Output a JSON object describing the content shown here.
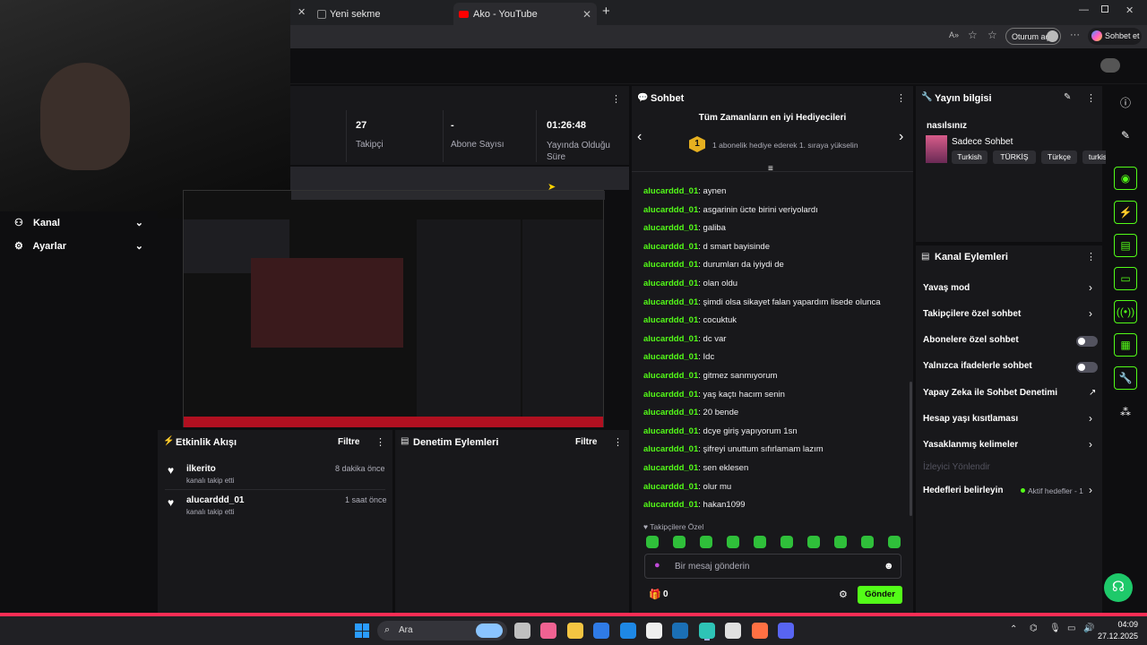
{
  "browser": {
    "tabs": [
      {
        "label": "Yeni sekme"
      },
      {
        "label": "Ako - YouTube"
      }
    ],
    "signin_label": "Oturum aç",
    "copilot_label": "Sohbet et"
  },
  "stats": [
    {
      "value": "27",
      "label": "Takipçi"
    },
    {
      "value": "-",
      "label": "Abone Sayısı"
    },
    {
      "value": "01:26:48",
      "label": "Yayında Olduğu Süre"
    }
  ],
  "sidebar": {
    "items": [
      {
        "label": "Kanal"
      },
      {
        "label": "Ayarlar"
      }
    ]
  },
  "activity": {
    "title": "Etkinlik Akışı",
    "filter": "Filtre",
    "events": [
      {
        "user": "ilkerito",
        "text": "kanalı takip etti",
        "time": "8 dakika önce"
      },
      {
        "user": "alucarddd_01",
        "text": "kanalı takip etti",
        "time": "1 saat önce"
      }
    ]
  },
  "moderation": {
    "title": "Denetim Eylemleri",
    "filter": "Filtre"
  },
  "chat": {
    "title": "Sohbet",
    "banner_title": "Tüm Zamanların en iyi Hediyecileri",
    "banner_rank": "1",
    "banner_text": "1 abonelik hediye ederek 1. sıraya yükselin",
    "messages": [
      {
        "user": "alucarddd_01",
        "text": "aynen"
      },
      {
        "user": "alucarddd_01",
        "text": "asgarinin ücte birini veriyolardı"
      },
      {
        "user": "alucarddd_01",
        "text": "galiba"
      },
      {
        "user": "alucarddd_01",
        "text": "d smart bayisinde"
      },
      {
        "user": "alucarddd_01",
        "text": "durumları da iyiydi de"
      },
      {
        "user": "alucarddd_01",
        "text": "olan oldu"
      },
      {
        "user": "alucarddd_01",
        "text": "şimdi olsa sikayet falan yapardım lisede olunca"
      },
      {
        "user": "alucarddd_01",
        "text": "cocuktuk"
      },
      {
        "user": "alucarddd_01",
        "text": "dc var"
      },
      {
        "user": "alucarddd_01",
        "text": "Idc"
      },
      {
        "user": "alucarddd_01",
        "text": "gitmez sanmıyorum"
      },
      {
        "user": "alucarddd_01",
        "text": "yaş kaçtı hacım senin"
      },
      {
        "user": "alucarddd_01",
        "text": "20 bende"
      },
      {
        "user": "alucarddd_01",
        "text": "dcye giriş yapıyorum 1sn"
      },
      {
        "user": "alucarddd_01",
        "text": "şifreyi unuttum sıfırlamam lazım"
      },
      {
        "user": "alucarddd_01",
        "text": "sen eklesen"
      },
      {
        "user": "alucarddd_01",
        "text": "olur mu"
      },
      {
        "user": "alucarddd_01",
        "text": "hakan1099"
      }
    ],
    "followers_only_label": "Takipçilere Özel",
    "input_placeholder": "Bir mesaj gönderin",
    "points": "0",
    "send_label": "Gönder"
  },
  "stream_info": {
    "title": "Yayın bilgisi",
    "stream_title": "nasılsınız",
    "category": "Sadece Sohbet",
    "tags": [
      "Turkish",
      "TÜRKİŞ",
      "Türkçe",
      "turkis"
    ]
  },
  "channel_actions": {
    "title": "Kanal Eylemleri",
    "items": [
      {
        "label": "Yavaş mod",
        "control": "chevron"
      },
      {
        "label": "Takipçilere özel sohbet",
        "control": "chevron"
      },
      {
        "label": "Abonelere özel sohbet",
        "control": "toggle"
      },
      {
        "label": "Yalnızca ifadelerle sohbet",
        "control": "toggle"
      },
      {
        "label": "Yapay Zeka ile Sohbet Denetimi",
        "control": "external"
      },
      {
        "label": "Hesap yaşı kısıtlaması",
        "control": "chevron"
      },
      {
        "label": "Yasaklanmış kelimeler",
        "control": "chevron"
      },
      {
        "label": "İzleyici Yönlendir",
        "control": "disabled"
      },
      {
        "label": "Hedefleri belirleyin",
        "control": "chevron",
        "status": "Aktif hedefler - 1"
      }
    ]
  },
  "taskbar": {
    "search_label": "Ara",
    "time": "04:09",
    "date": "27.12.2025"
  },
  "colors": {
    "accent": "#53fc18",
    "panel": "#18181b",
    "bg": "#0e0e10"
  }
}
